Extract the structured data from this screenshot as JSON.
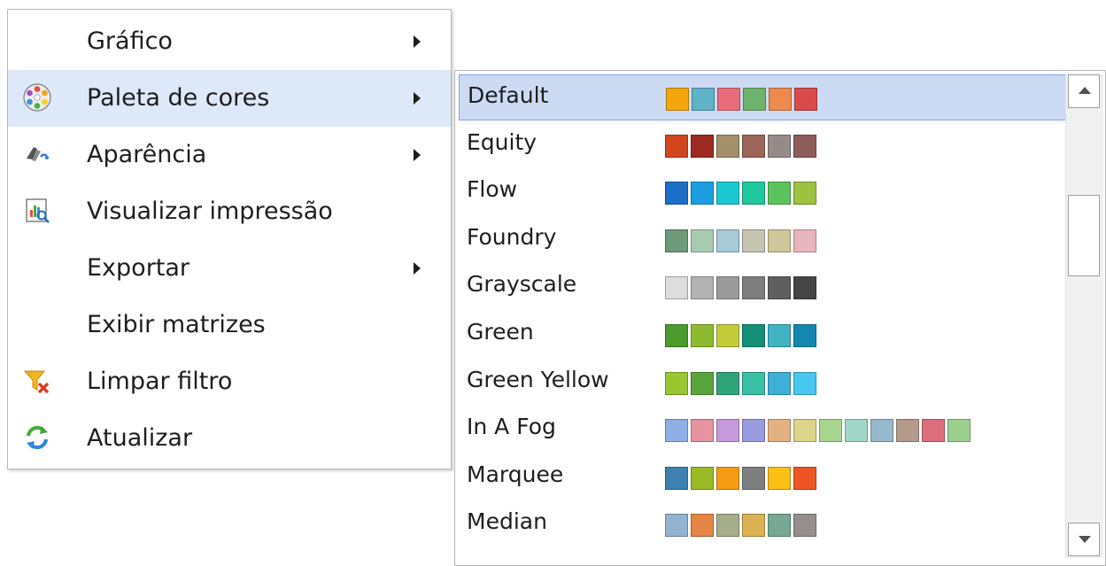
{
  "menu": {
    "items": [
      {
        "label": "Gráfico",
        "icon": "",
        "submenu": true
      },
      {
        "label": "Paleta de cores",
        "icon": "color-palette-icon",
        "submenu": true,
        "highlighted": true
      },
      {
        "label": "Aparência",
        "icon": "paint-brush-icon",
        "submenu": true
      },
      {
        "label": "Visualizar impressão",
        "icon": "print-preview-icon",
        "submenu": false
      },
      {
        "label": "Exportar",
        "icon": "",
        "submenu": true
      },
      {
        "label": "Exibir matrizes",
        "icon": "",
        "submenu": false
      },
      {
        "label": "Limpar filtro",
        "icon": "clear-filter-icon",
        "submenu": false
      },
      {
        "label": "Atualizar",
        "icon": "refresh-icon",
        "submenu": false
      }
    ]
  },
  "palette_submenu": {
    "selected": "Default",
    "items": [
      {
        "name": "Default",
        "colors": [
          "#f4a70c",
          "#5fb3c8",
          "#e86c7a",
          "#6eb46c",
          "#ee8a4b",
          "#d94a4a"
        ]
      },
      {
        "name": "Equity",
        "colors": [
          "#d2461e",
          "#9c2a22",
          "#a38f6a",
          "#9b6657",
          "#958c89",
          "#8f5c5c"
        ]
      },
      {
        "name": "Flow",
        "colors": [
          "#1c6fc6",
          "#1b9fe2",
          "#1bc8d2",
          "#1ec79d",
          "#5cc25e",
          "#9cc240"
        ]
      },
      {
        "name": "Foundry",
        "colors": [
          "#6d9a78",
          "#a8cbb0",
          "#a6cad6",
          "#c4c4b0",
          "#cfc79b",
          "#e6b6bc"
        ]
      },
      {
        "name": "Grayscale",
        "colors": [
          "#dddddd",
          "#b3b3b3",
          "#9a9a9a",
          "#7e7e7e",
          "#5f5f5f",
          "#454545"
        ]
      },
      {
        "name": "Green",
        "colors": [
          "#4c9c2d",
          "#8dbb2f",
          "#c3cc38",
          "#139075",
          "#41b3c3",
          "#1487b0"
        ]
      },
      {
        "name": "Green Yellow",
        "colors": [
          "#9ac731",
          "#58a43b",
          "#2fa37a",
          "#38c1a4",
          "#3eafd6",
          "#48c7f0"
        ]
      },
      {
        "name": "In A Fog",
        "colors": [
          "#90aee6",
          "#e493a0",
          "#c698dc",
          "#9a9ae0",
          "#e5b183",
          "#dcd488",
          "#a8d58d",
          "#9fd6c8",
          "#98b8cc",
          "#b49a8a",
          "#dd6e7d",
          "#9ccf8e"
        ]
      },
      {
        "name": "Marquee",
        "colors": [
          "#3c81b0",
          "#9ab925",
          "#f59b14",
          "#7f7f7f",
          "#fbc013",
          "#ee5424"
        ]
      },
      {
        "name": "Median",
        "colors": [
          "#93b3d0",
          "#e48546",
          "#a5ad8a",
          "#dbb152",
          "#76a893",
          "#958e8c"
        ]
      }
    ]
  }
}
